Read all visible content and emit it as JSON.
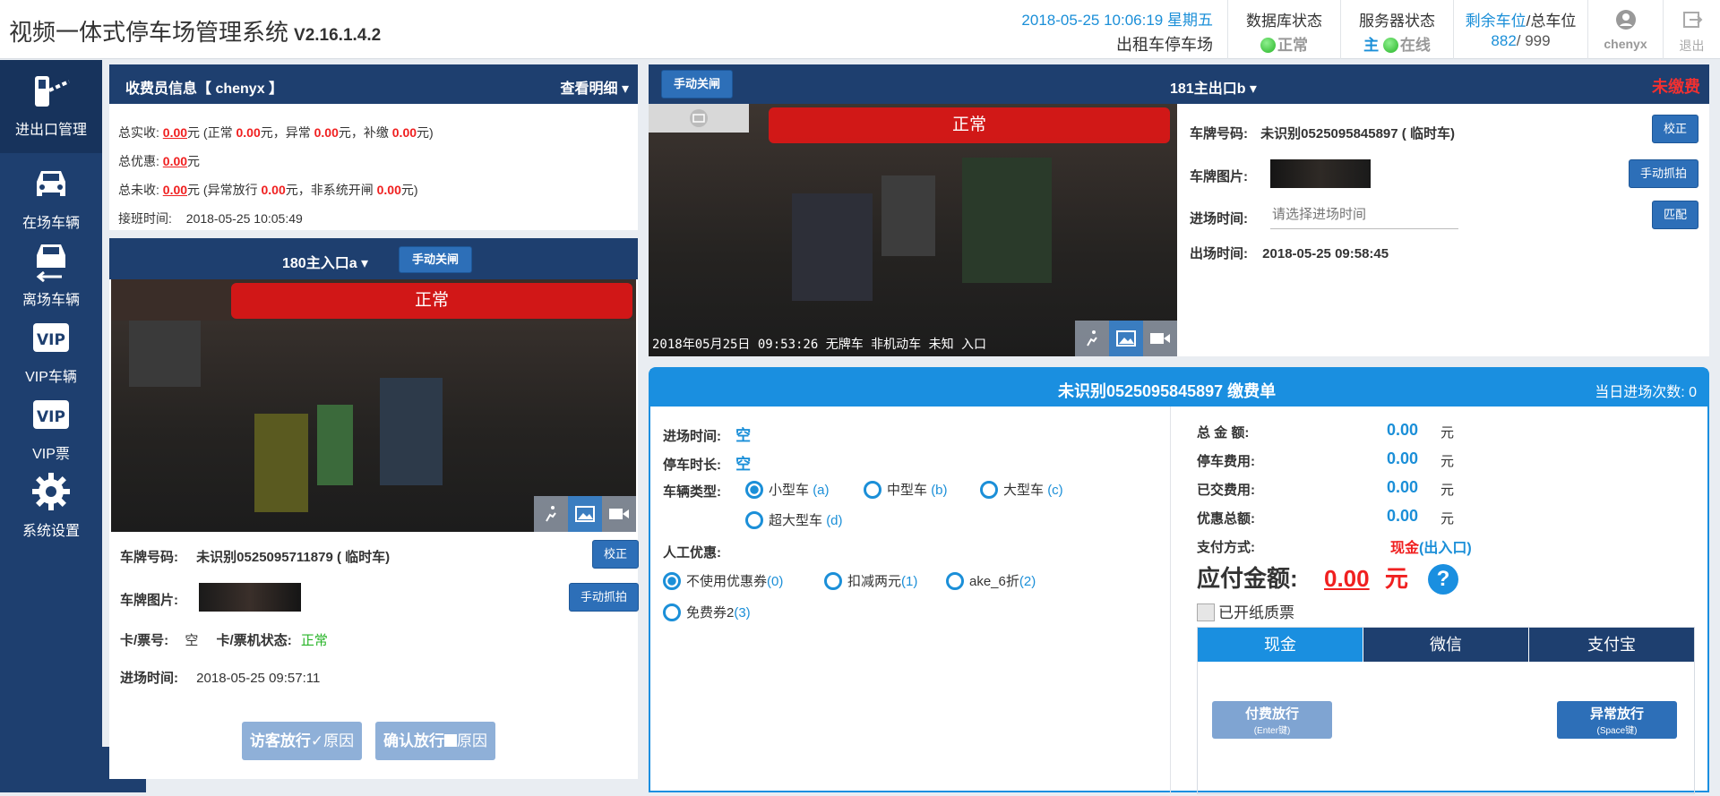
{
  "app": {
    "title": "视频一体式停车场管理系统",
    "version": "V2.16.1.4.2",
    "datetime": "2018-05-25 10:06:19 星期五",
    "lot_name": "出租车停车场"
  },
  "status": {
    "db_label": "数据库状态",
    "db_value": "正常",
    "server_label": "服务器状态",
    "server_main": "主",
    "server_value": "在线",
    "spaces_label_remaining": "剩余车位",
    "spaces_label_total": "/总车位",
    "spaces_remaining": "882",
    "spaces_total": "/ 999",
    "user": "chenyx",
    "logout": "退出"
  },
  "sidebar": {
    "items": [
      {
        "label": "进出口管理",
        "icon": "barrier-gate-icon"
      },
      {
        "label": "在场车辆",
        "icon": "car-icon"
      },
      {
        "label": "离场车辆",
        "icon": "car-leaving-icon"
      },
      {
        "label": "VIP车辆",
        "icon": "vip-icon"
      },
      {
        "label": "VIP票",
        "icon": "vip-ticket-icon"
      },
      {
        "label": "系统设置",
        "icon": "gear-icon"
      }
    ]
  },
  "cashier": {
    "title": "收费员信息【 chenyx 】",
    "detail_link": "查看明细",
    "actual_label": "总实收:",
    "actual_value": "0.00",
    "yuan": "元",
    "actual_breakdown_pre": "(正常",
    "normal_value": "0.00",
    "abnormal_label": "元，异常",
    "abnormal_value": "0.00",
    "supplement_label": "元，补缴",
    "supplement_value": "0.00",
    "close_paren": "元)",
    "discount_label": "总优惠:",
    "discount_value": "0.00",
    "unpaid_label": "总未收:",
    "unpaid_value": "0.00",
    "unpaid_pre": "(异常放行",
    "abnormal_release_value": "0.00",
    "nonsys_label": "元，非系统开闸",
    "nonsys_value": "0.00",
    "shift_label": "接班时间:",
    "shift_time": "2018-05-25 10:05:49"
  },
  "entrance": {
    "name": "180主入口a",
    "manual_close": "手动关闸",
    "cam_status": "正常",
    "plate_label": "车牌号码:",
    "plate_value": "未识别0525095711879 ( 临时车)",
    "correct_btn": "校正",
    "plate_img_label": "车牌图片:",
    "capture_btn": "手动抓拍",
    "card_label": "卡/票号:",
    "card_value": "空",
    "card_status_label": "卡/票机状态:",
    "card_status_value": "正常",
    "entry_time_label": "进场时间:",
    "entry_time": "2018-05-25 09:57:11",
    "visitor_btn": "访客放行",
    "confirm_btn": "确认放行",
    "reason": "原因"
  },
  "exit": {
    "manual_close": "手动关闸",
    "name": "181主出口b",
    "pay_status": "未缴费",
    "cam_status": "正常",
    "overlay": "2018年05月25日  09:53:26  无牌车  非机动车  未知  入口",
    "plate_label": "车牌号码:",
    "plate_value": "未识别0525095845897 ( 临时车)",
    "correct_btn": "校正",
    "plate_img_label": "车牌图片:",
    "capture_btn": "手动抓拍",
    "entry_time_label": "进场时间:",
    "entry_time_placeholder": "请选择进场时间",
    "match_btn": "匹配",
    "exit_time_label": "出场时间:",
    "exit_time": "2018-05-25 09:58:45"
  },
  "bill": {
    "title": "未识别0525095845897  缴费单",
    "entries_label": "当日进场次数:",
    "entries_value": "0",
    "entry_time_label": "进场时间:",
    "entry_time": "空",
    "duration_label": "停车时长:",
    "duration": "空",
    "vehicle_type_label": "车辆类型:",
    "vehicle_types": [
      {
        "label": "小型车",
        "key": "(a)",
        "checked": true
      },
      {
        "label": "中型车",
        "key": "(b)",
        "checked": false
      },
      {
        "label": "大型车",
        "key": "(c)",
        "checked": false
      },
      {
        "label": "超大型车",
        "key": "(d)",
        "checked": false
      }
    ],
    "discount_label": "人工优惠:",
    "discounts": [
      {
        "label": "不使用优惠券",
        "key": "(0)",
        "checked": true
      },
      {
        "label": "扣减两元",
        "key": "(1)",
        "checked": false
      },
      {
        "label": "ake_6折",
        "key": "(2)",
        "checked": false
      },
      {
        "label": "免费券2",
        "key": "(3)",
        "checked": false
      }
    ],
    "total_label": "总 金 额:",
    "total": "0.00",
    "parking_fee_label": "停车费用:",
    "parking_fee": "0.00",
    "paid_label": "已交费用:",
    "paid": "0.00",
    "discount_total_label": "优惠总额:",
    "discount_total": "0.00",
    "unit": "元",
    "pay_method_label": "支付方式:",
    "pay_method": "现金",
    "pay_method_src": "(出入口)",
    "due_label": "应付金额:",
    "due": "0.00",
    "due_unit": "元",
    "invoice_label": "已开纸质票",
    "tabs": [
      "现金",
      "微信",
      "支付宝"
    ],
    "pay_btn": "付费放行",
    "pay_btn_key": "(Enter键)",
    "abnormal_btn": "异常放行",
    "abnormal_btn_key": "(Space键)"
  }
}
